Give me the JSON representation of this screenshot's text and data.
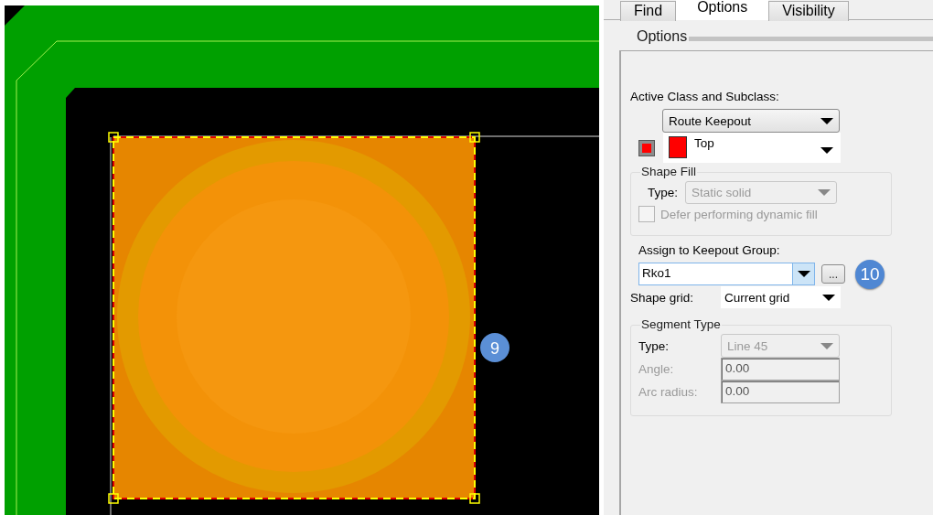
{
  "canvas": {
    "badge": "9"
  },
  "tabs": [
    {
      "label": "Find",
      "selected": false
    },
    {
      "label": "Options",
      "selected": true
    },
    {
      "label": "Visibility",
      "selected": false
    }
  ],
  "section_title": "Options",
  "active_class": {
    "label": "Active Class and Subclass:",
    "class_value": "Route Keepout",
    "subclass_value": "Top",
    "color": "#ff0000"
  },
  "shape_fill": {
    "title": "Shape Fill",
    "type_label": "Type:",
    "type_value": "Static solid",
    "disabled": true,
    "defer": {
      "label": "Defer performing dynamic fill",
      "checked": false,
      "disabled": true
    }
  },
  "keepout_group": {
    "label": "Assign to Keepout Group:",
    "value": "Rko1",
    "browse": "...",
    "badge": "10"
  },
  "shape_grid": {
    "label": "Shape grid:",
    "value": "Current grid"
  },
  "segment_type": {
    "title": "Segment Type",
    "fields": [
      {
        "kind": "dropdown",
        "label": "Type:",
        "label_disabled": false,
        "value": "Line 45",
        "disabled": true
      },
      {
        "kind": "text",
        "label": "Angle:",
        "label_disabled": true,
        "value": "0.00",
        "disabled": true
      },
      {
        "kind": "text",
        "label": "Arc radius:",
        "label_disabled": true,
        "value": "0.00",
        "disabled": true
      }
    ]
  }
}
